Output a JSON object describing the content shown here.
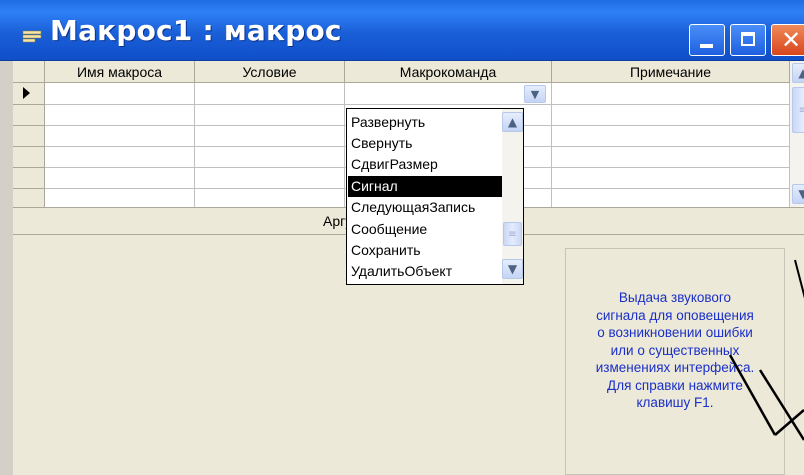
{
  "window": {
    "title": "Макрос1 : макрос",
    "controls": {
      "minimize_icon": "minimize-icon",
      "maximize_icon": "maximize-icon",
      "close_glyph": "✕"
    }
  },
  "grid": {
    "columns": [
      "Имя макроса",
      "Условие",
      "Макрокоманда",
      "Примечание"
    ],
    "rows": [
      [
        "",
        "",
        "",
        ""
      ],
      [
        "",
        "",
        "",
        ""
      ],
      [
        "",
        "",
        "",
        ""
      ],
      [
        "",
        "",
        "",
        ""
      ],
      [
        "",
        "",
        "",
        ""
      ],
      [
        "",
        "",
        "",
        ""
      ]
    ],
    "current_row_marker": "▶"
  },
  "dropdown": {
    "options": [
      "Развернуть",
      "Свернуть",
      "СдвигРазмер",
      "Сигнал",
      "СледующаяЗапись",
      "Сообщение",
      "Сохранить",
      "УдалитьОбъект"
    ],
    "selected": "Сигнал"
  },
  "arguments": {
    "label": "Аргу"
  },
  "help": {
    "text": "Выдача звукового\nсигнала для оповещения\nо возникновении ошибки\nили о существенных\nизменениях интерфейса.\nДля справки нажмите\nклавишу F1."
  },
  "colors": {
    "title_bar": "#1f6de3",
    "help_text": "#1a2fc8",
    "selection": "#000000"
  }
}
